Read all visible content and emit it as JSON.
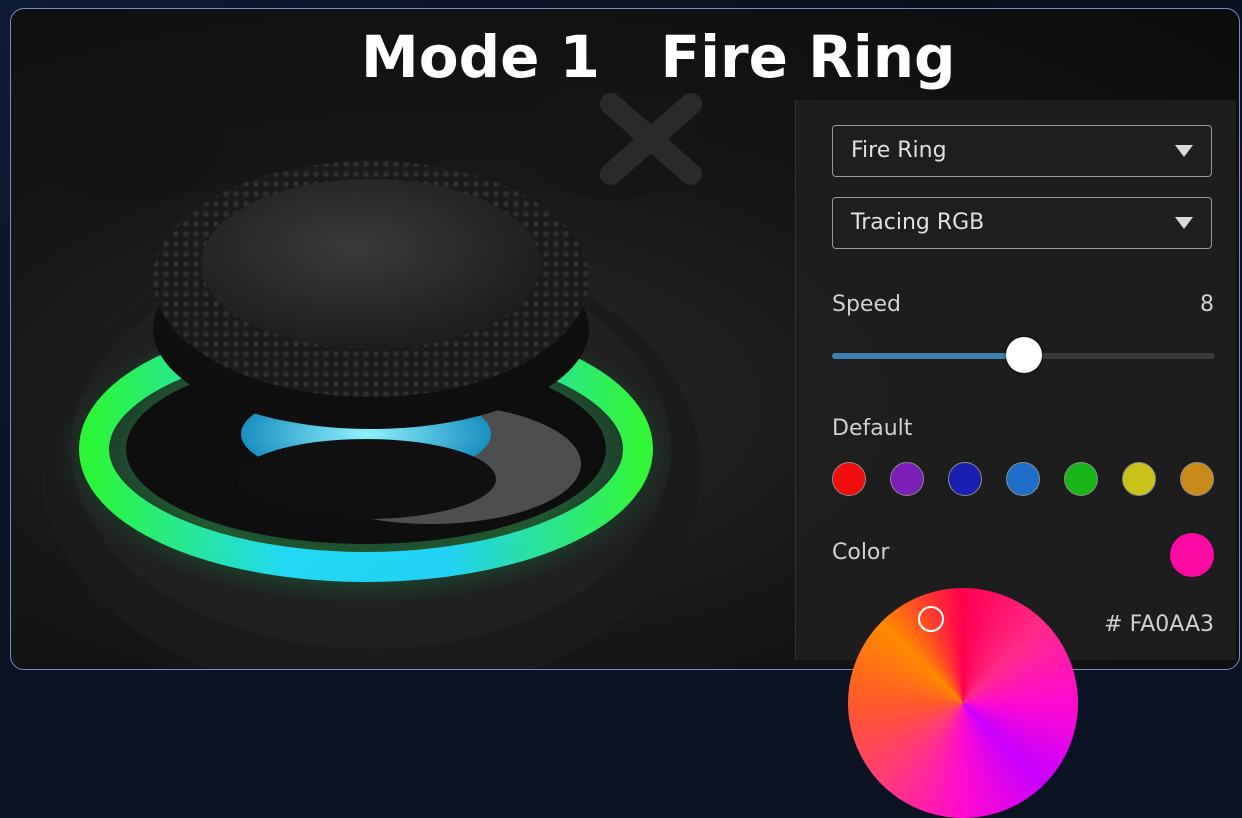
{
  "title": "Mode 1   Fire Ring",
  "panel": {
    "mode_select": {
      "value": "Fire Ring"
    },
    "effect_select": {
      "value": "Tracing RGB"
    },
    "speed": {
      "label": "Speed",
      "value": "8",
      "fraction": 0.5
    },
    "default_label": "Default",
    "swatches": [
      {
        "name": "red",
        "color": "#f20d0d"
      },
      {
        "name": "purple",
        "color": "#7b1fb8"
      },
      {
        "name": "navy",
        "color": "#1a1fb0"
      },
      {
        "name": "blue",
        "color": "#1f6fc9"
      },
      {
        "name": "green",
        "color": "#19b619"
      },
      {
        "name": "yellow",
        "color": "#c9c21a"
      },
      {
        "name": "amber",
        "color": "#c98a1a"
      }
    ],
    "color_label": "Color",
    "current_color": "#FA0AA3",
    "hex_value": "#  FA0AA3"
  }
}
